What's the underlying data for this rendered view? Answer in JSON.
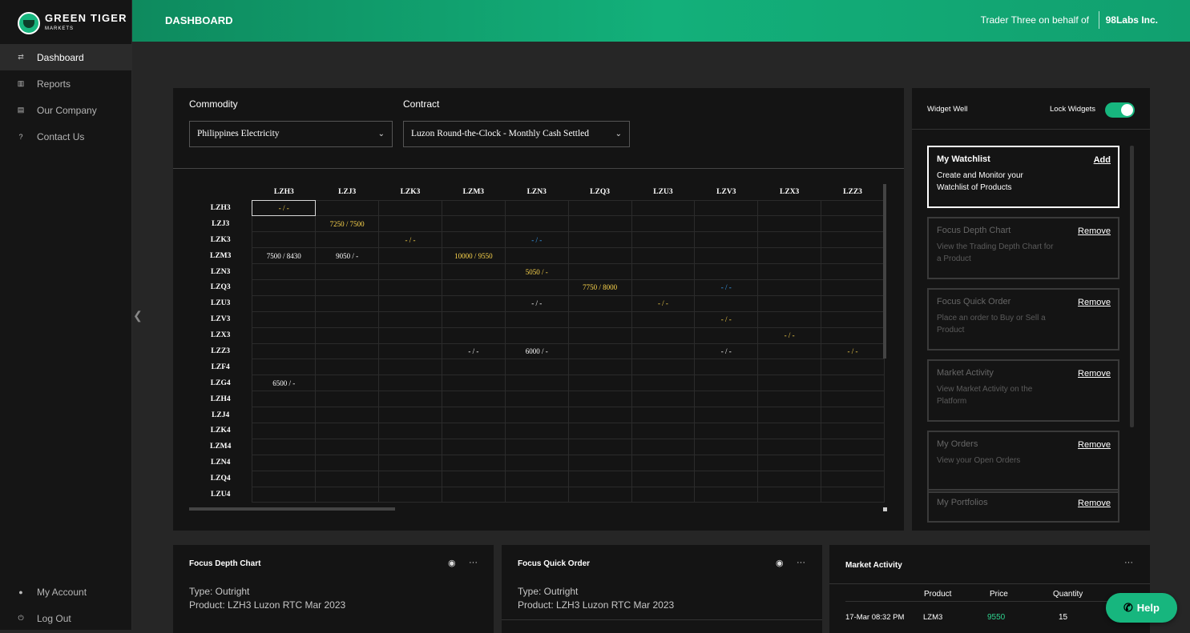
{
  "brand": {
    "name": "GREEN TIGER",
    "sub": "MARKETS"
  },
  "nav": {
    "items": [
      {
        "label": "Dashboard",
        "icon": "swap-icon",
        "glyph": "⇄"
      },
      {
        "label": "Reports",
        "icon": "chart-icon",
        "glyph": "▥"
      },
      {
        "label": "Our Company",
        "icon": "building-icon",
        "glyph": "▤"
      },
      {
        "label": "Contact Us",
        "icon": "help-circle-icon",
        "glyph": "?"
      }
    ],
    "bottom": [
      {
        "label": "My Account",
        "icon": "user-icon",
        "glyph": "●"
      },
      {
        "label": "Log Out",
        "icon": "logout-icon",
        "glyph": "⏻"
      }
    ]
  },
  "header": {
    "title": "DASHBOARD",
    "user": "Trader Three on behalf of",
    "org": "98Labs Inc."
  },
  "filters": {
    "commodity_label": "Commodity",
    "commodity_value": "Philippines Electricity",
    "contract_label": "Contract",
    "contract_value": "Luzon Round-the-Clock - Monthly Cash Settled"
  },
  "matrix": {
    "columns": [
      "LZH3",
      "LZJ3",
      "LZK3",
      "LZM3",
      "LZN3",
      "LZQ3",
      "LZU3",
      "LZV3",
      "LZX3",
      "LZZ3"
    ],
    "rows": [
      {
        "label": "LZH3",
        "cells": [
          {
            "c": 0,
            "v": "- / -",
            "k": "y"
          }
        ]
      },
      {
        "label": "LZJ3",
        "cells": [
          {
            "c": 1,
            "v": "7250 / 7500",
            "k": "y"
          }
        ]
      },
      {
        "label": "LZK3",
        "cells": [
          {
            "c": 2,
            "v": "- / -",
            "k": "y"
          },
          {
            "c": 4,
            "v": "- / -",
            "k": "b"
          }
        ]
      },
      {
        "label": "LZM3",
        "cells": [
          {
            "c": 0,
            "v": "7500 / 8430",
            "k": "w"
          },
          {
            "c": 1,
            "v": "9050 / -",
            "k": "w"
          },
          {
            "c": 3,
            "v": "10000 / 9550",
            "k": "y"
          }
        ]
      },
      {
        "label": "LZN3",
        "cells": [
          {
            "c": 4,
            "v": "5050 / -",
            "k": "y"
          }
        ]
      },
      {
        "label": "LZQ3",
        "cells": [
          {
            "c": 5,
            "v": "7750 / 8000",
            "k": "y"
          },
          {
            "c": 7,
            "v": "- / -",
            "k": "b"
          }
        ]
      },
      {
        "label": "LZU3",
        "cells": [
          {
            "c": 4,
            "v": "- / -",
            "k": "w"
          },
          {
            "c": 6,
            "v": "- / -",
            "k": "y"
          }
        ]
      },
      {
        "label": "LZV3",
        "cells": [
          {
            "c": 7,
            "v": "- / -",
            "k": "y"
          }
        ]
      },
      {
        "label": "LZX3",
        "cells": [
          {
            "c": 8,
            "v": "- / -",
            "k": "y"
          }
        ]
      },
      {
        "label": "LZZ3",
        "cells": [
          {
            "c": 3,
            "v": "- / -",
            "k": "w"
          },
          {
            "c": 4,
            "v": "6000 / -",
            "k": "w"
          },
          {
            "c": 7,
            "v": "- / -",
            "k": "w"
          },
          {
            "c": 9,
            "v": "- / -",
            "k": "y"
          }
        ]
      },
      {
        "label": "LZF4",
        "cells": []
      },
      {
        "label": "LZG4",
        "cells": [
          {
            "c": 0,
            "v": "6500 / -",
            "k": "w"
          }
        ]
      },
      {
        "label": "LZH4",
        "cells": []
      },
      {
        "label": "LZJ4",
        "cells": []
      },
      {
        "label": "LZK4",
        "cells": []
      },
      {
        "label": "LZM4",
        "cells": []
      },
      {
        "label": "LZN4",
        "cells": []
      },
      {
        "label": "LZQ4",
        "cells": []
      },
      {
        "label": "LZU4",
        "cells": []
      }
    ]
  },
  "widget_well": {
    "title": "Widget Well",
    "lock_label": "Lock Widgets",
    "lock_on": true,
    "cards": [
      {
        "title": "My Watchlist",
        "desc": "Create and Monitor your Watchlist of Products",
        "action": "Add",
        "active": true
      },
      {
        "title": "Focus Depth Chart",
        "desc": "View the Trading Depth Chart for a Product",
        "action": "Remove",
        "active": false
      },
      {
        "title": "Focus Quick Order",
        "desc": "Place an order to Buy or Sell a Product",
        "action": "Remove",
        "active": false
      },
      {
        "title": "Market Activity",
        "desc": "View Market Activity on the Platform",
        "action": "Remove",
        "active": false
      },
      {
        "title": "My Orders",
        "desc": "View your Open Orders",
        "action": "Remove",
        "active": false
      },
      {
        "title": "My Portfolios",
        "desc": "",
        "action": "Remove",
        "active": false
      }
    ]
  },
  "widgets": {
    "depth": {
      "title": "Focus Depth Chart",
      "type": "Type: Outright",
      "product": "Product: LZH3 Luzon RTC Mar 2023"
    },
    "quick": {
      "title": "Focus Quick Order",
      "type": "Type: Outright",
      "product": "Product: LZH3 Luzon RTC Mar 2023"
    },
    "market": {
      "title": "Market Activity",
      "headers": [
        "Product",
        "Price",
        "Quantity"
      ],
      "row": {
        "time": "17-Mar 08:32 PM",
        "product": "LZM3",
        "price": "9550",
        "qty": "15"
      }
    }
  },
  "help_label": "Help",
  "colors": {
    "accent": "#17b67e",
    "yellow": "#ffd84d",
    "blue": "#3aa7ff"
  }
}
